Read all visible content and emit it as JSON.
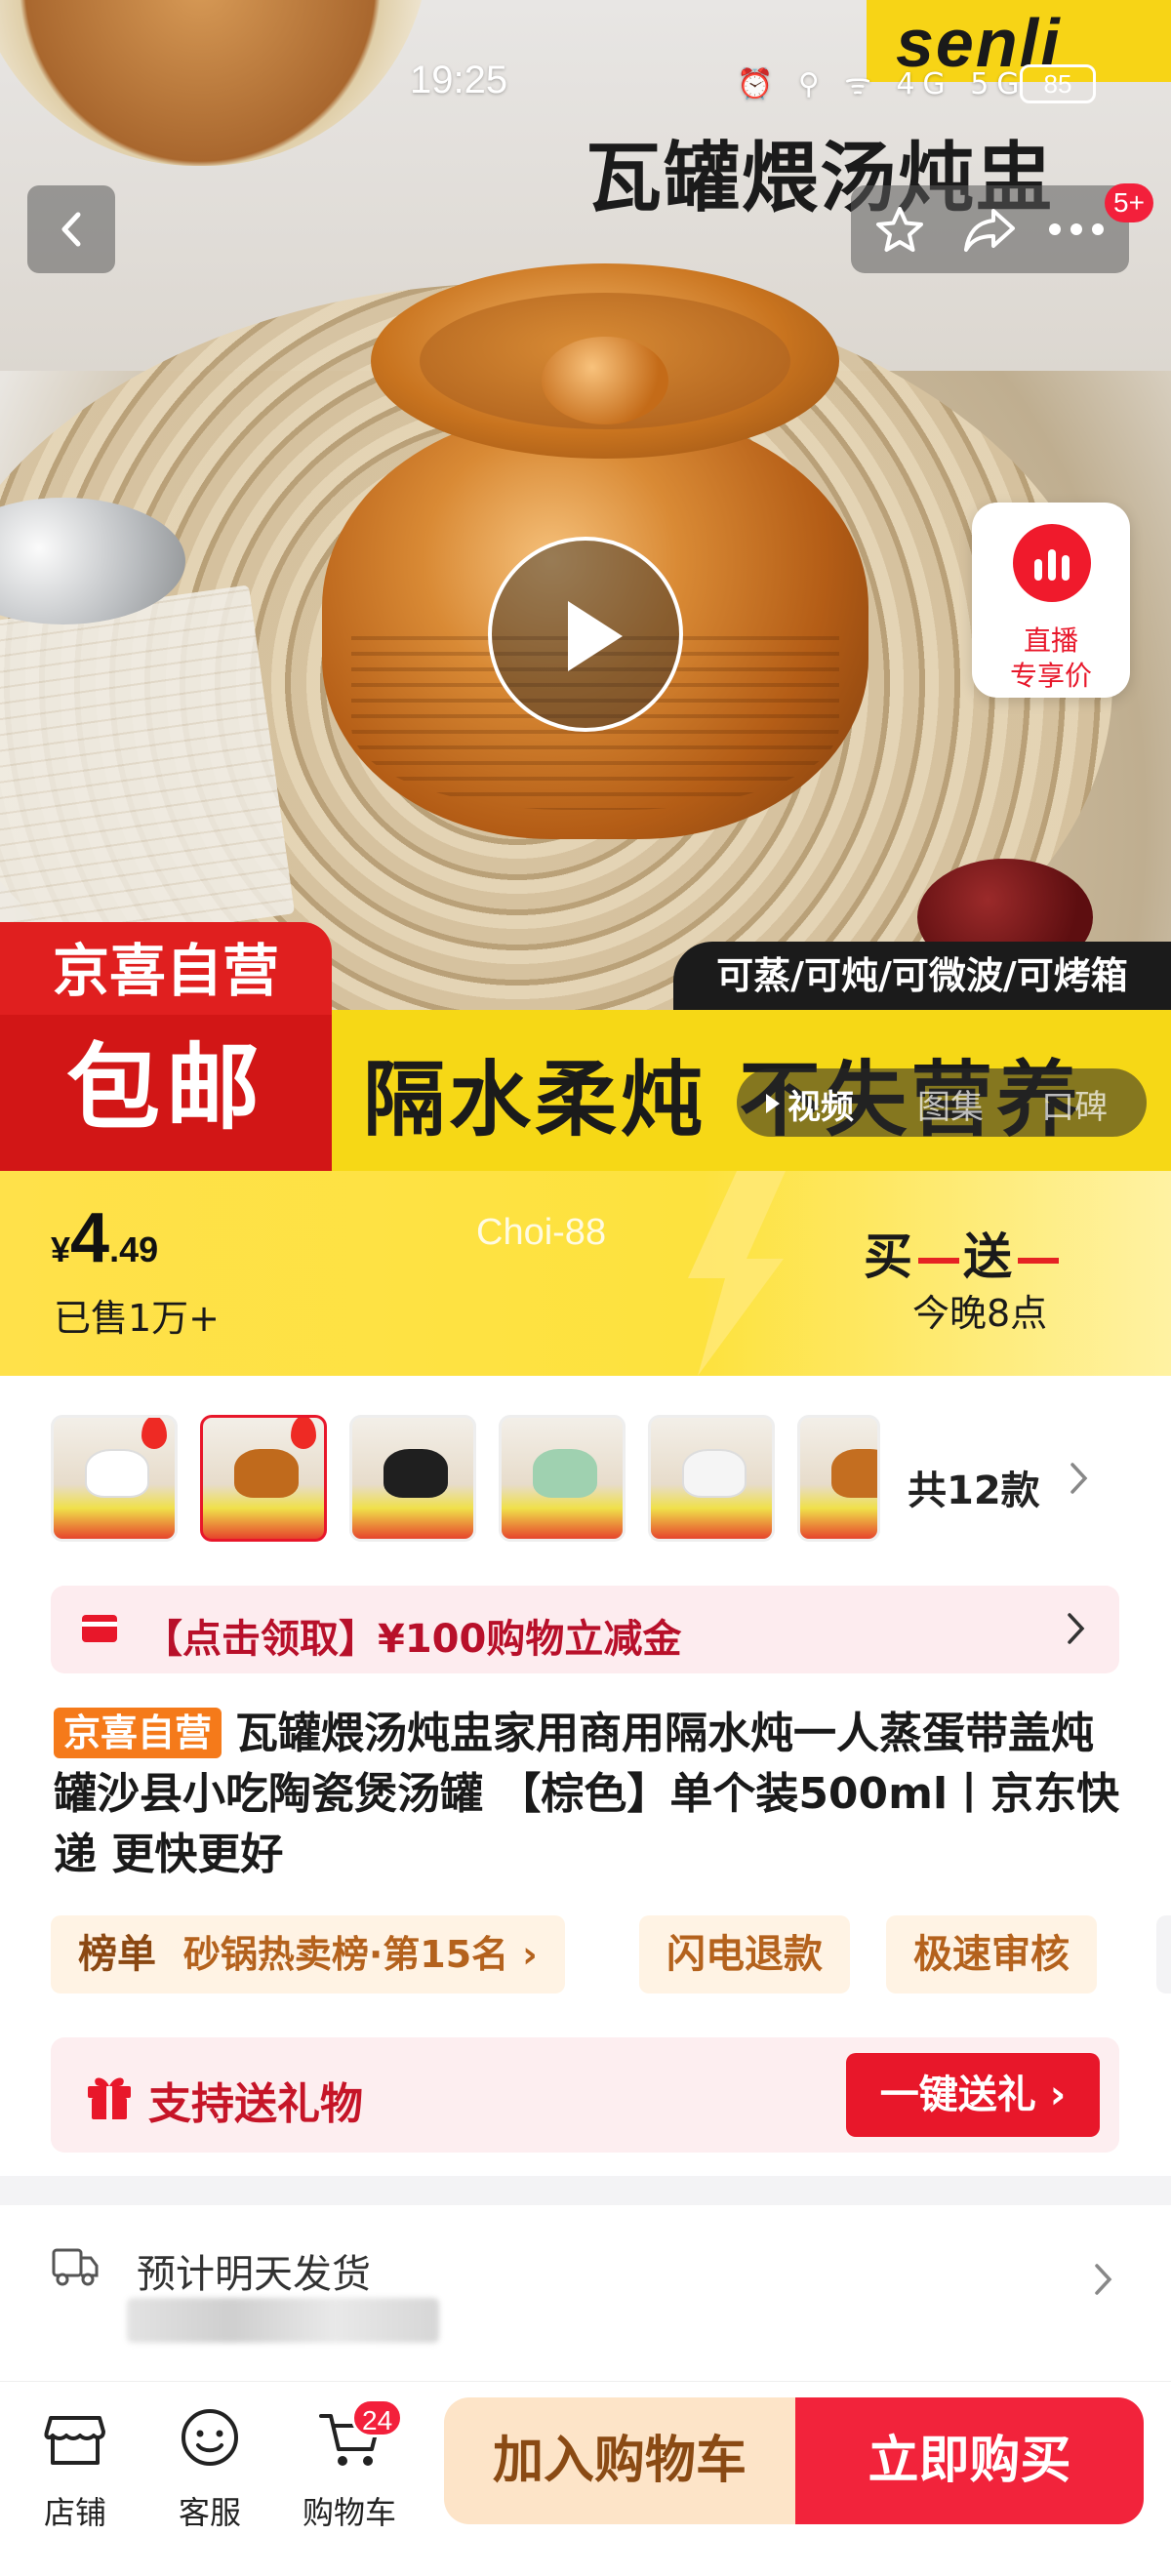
{
  "status_bar": {
    "time": "19:25",
    "icons": "⏰ ⚲ ᯤ 4G 5G",
    "battery": "85"
  },
  "hero": {
    "brand_logo": "senli",
    "title": "瓦罐煨汤炖盅",
    "more_badge": "5+",
    "live_line1": "直播",
    "live_line2": "专享价",
    "badge_top": "京喜自营",
    "badge_bottom": "包邮",
    "feature_tag": "可蒸/可炖/可微波/可烤箱",
    "slogan": "隔水柔炖 不失营养",
    "media_tabs": [
      "视频",
      "图集",
      "口碑"
    ]
  },
  "price": {
    "currency": "¥",
    "integer": "4",
    "decimal": ".49",
    "sold": "已售1万+",
    "shop_watermark": "Choi-88",
    "promo_a": "买",
    "promo_b": "送",
    "promo_time": "今晚8点"
  },
  "variants": {
    "count_label": "共12款",
    "items": [
      {
        "color": "#ffffff",
        "hot": true
      },
      {
        "color": "#c06a1c",
        "hot": true,
        "selected": true
      },
      {
        "color": "#1f1f1f",
        "hot": false
      },
      {
        "color": "#9fd1b0",
        "hot": false
      },
      {
        "color": "#f5f5f5",
        "hot": false
      },
      {
        "color": "#c46e20",
        "hot": false
      }
    ]
  },
  "coupon": {
    "text": "【点击领取】¥100购物立减金"
  },
  "product": {
    "tag": "京喜自营",
    "title": "瓦罐煨汤炖盅家用商用隔水炖一人蒸蛋带盖炖罐沙县小吃陶瓷煲汤罐 【棕色】单个装500ml丨京东快递 更快更好"
  },
  "chips": {
    "rank_label": "榜单",
    "rank_text": "砂锅热卖榜·第15名",
    "c2": "闪电退款",
    "c3": "极速审核"
  },
  "gift": {
    "label": "支持送礼物",
    "button": "一键送礼"
  },
  "delivery": {
    "text": "预计明天发货"
  },
  "bottom": {
    "store": "店铺",
    "service": "客服",
    "cart": "购物车",
    "cart_count": "24",
    "add_cart": "加入购物车",
    "buy_now": "立即购买"
  },
  "colors": {
    "accent_red": "#e8172a",
    "banner_yellow": "#f6d816",
    "cart_button_bg": "#fde4c8"
  }
}
